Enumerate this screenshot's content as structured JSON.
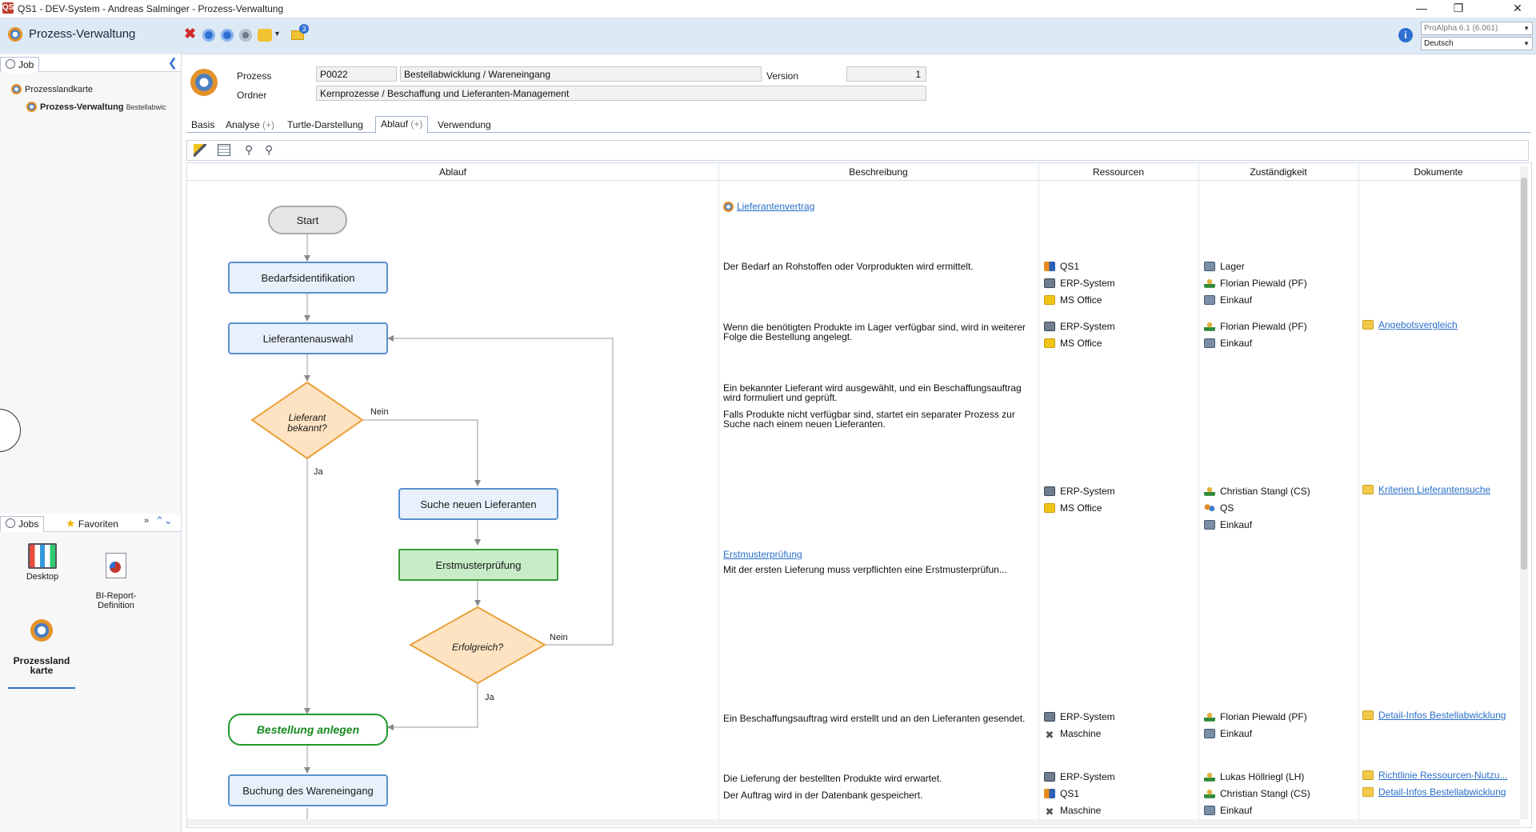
{
  "window": {
    "title": "QS1 - DEV-System - Andreas Salminger - Prozess-Verwaltung",
    "app_icon": "QS"
  },
  "toolbar": {
    "title": "Prozess-Verwaltung",
    "badge": "3",
    "version_select": "ProAlpha 6.1 (6.061)",
    "language_select": "Deutsch"
  },
  "left": {
    "tab_job": "Job",
    "tree": {
      "root": "Prozesslandkarte",
      "child": "Prozess-Verwaltung",
      "child_suffix": "Bestellabwic"
    },
    "bottom_tabs": {
      "jobs": "Jobs",
      "favorites": "Favoriten"
    },
    "shortcuts": [
      {
        "label": "Desktop"
      },
      {
        "label": "BI-Report-\nDefinition"
      },
      {
        "label": "Prozessland\nkarte"
      }
    ]
  },
  "header": {
    "process_label": "Prozess",
    "process_id": "P0022",
    "process_name": "Bestellabwicklung / Wareneingang",
    "version_label": "Version",
    "version_value": "1",
    "folder_label": "Ordner",
    "folder_value": "Kernprozesse / Beschaffung und Lieferanten-Management"
  },
  "tabs": [
    {
      "label": "Basis",
      "plus": ""
    },
    {
      "label": "Analyse",
      "plus": "(+)"
    },
    {
      "label": "Turtle-Darstellung",
      "plus": ""
    },
    {
      "label": "Ablauf",
      "plus": "(+)"
    },
    {
      "label": "Verwendung",
      "plus": ""
    }
  ],
  "columns": [
    "Ablauf",
    "Beschreibung",
    "Ressourcen",
    "Zuständigkeit",
    "Dokumente"
  ],
  "flow": {
    "start": "Start",
    "n1": "Bedarfsidentifikation",
    "n2": "Lieferantenauswahl",
    "d1": "Lieferant bekannt?",
    "d1_no": "Nein",
    "d1_yes": "Ja",
    "n3": "Suche neuen Lieferanten",
    "n4": "Erstmusterprüfung",
    "d2": "Erfolgreich?",
    "d2_no": "Nein",
    "d2_yes": "Ja",
    "n5": "Bestellung anlegen",
    "n6": "Buchung des Wareneingang"
  },
  "descriptions": {
    "top_link": "Lieferantenvertrag",
    "r1": "Der Bedarf an Rohstoffen oder Vorprodukten wird ermittelt.",
    "r2": "Wenn die benötigten Produkte im Lager verfügbar sind, wird in weiterer Folge die Bestellung angelegt.",
    "r3a": "Ein bekannter Lieferant wird ausgewählt, und ein Beschaffungsauftrag wird formuliert und geprüft.",
    "r3b": "Falls Produkte nicht verfügbar sind, startet ein separater Prozess zur Suche nach einem neuen Lieferanten.",
    "r4_link": "Erstmusterprüfung",
    "r4": "Mit der ersten Lieferung muss verpflichten eine Erstmusterprüfun...",
    "r5": "Ein Beschaffungsauftrag wird erstellt und an den Lieferanten gesendet.",
    "r6a": "Die Lieferung der bestellten Produkte wird erwartet.",
    "r6b": "Der Auftrag wird in der Datenbank gespeichert."
  },
  "resources": {
    "r1": [
      "QS1",
      "ERP-System",
      "MS Office"
    ],
    "r2": [
      "ERP-System",
      "MS Office"
    ],
    "r3": [
      "ERP-System",
      "MS Office"
    ],
    "r5": [
      "ERP-System",
      "Maschine"
    ],
    "r6": [
      "ERP-System",
      "QS1",
      "Maschine"
    ]
  },
  "responsibility": {
    "r1": [
      "Lager",
      "Florian Piewald (PF)",
      "Einkauf"
    ],
    "r2": [
      "Florian Piewald (PF)",
      "Einkauf"
    ],
    "r3": [
      "Christian Stangl (CS)",
      "QS",
      "Einkauf"
    ],
    "r5": [
      "Florian Piewald (PF)",
      "Einkauf"
    ],
    "r6": [
      "Lukas Höllriegl (LH)",
      "Christian Stangl (CS)",
      "Einkauf"
    ]
  },
  "documents": {
    "r2": "Angebotsvergleich",
    "r3": "Kriterien Lieferantensuche",
    "r5": "Detail-Infos Bestellabwicklung",
    "r6a": "Richtlinie Ressourcen-Nutzu...",
    "r6b": "Detail-Infos Bestellabwicklung"
  }
}
